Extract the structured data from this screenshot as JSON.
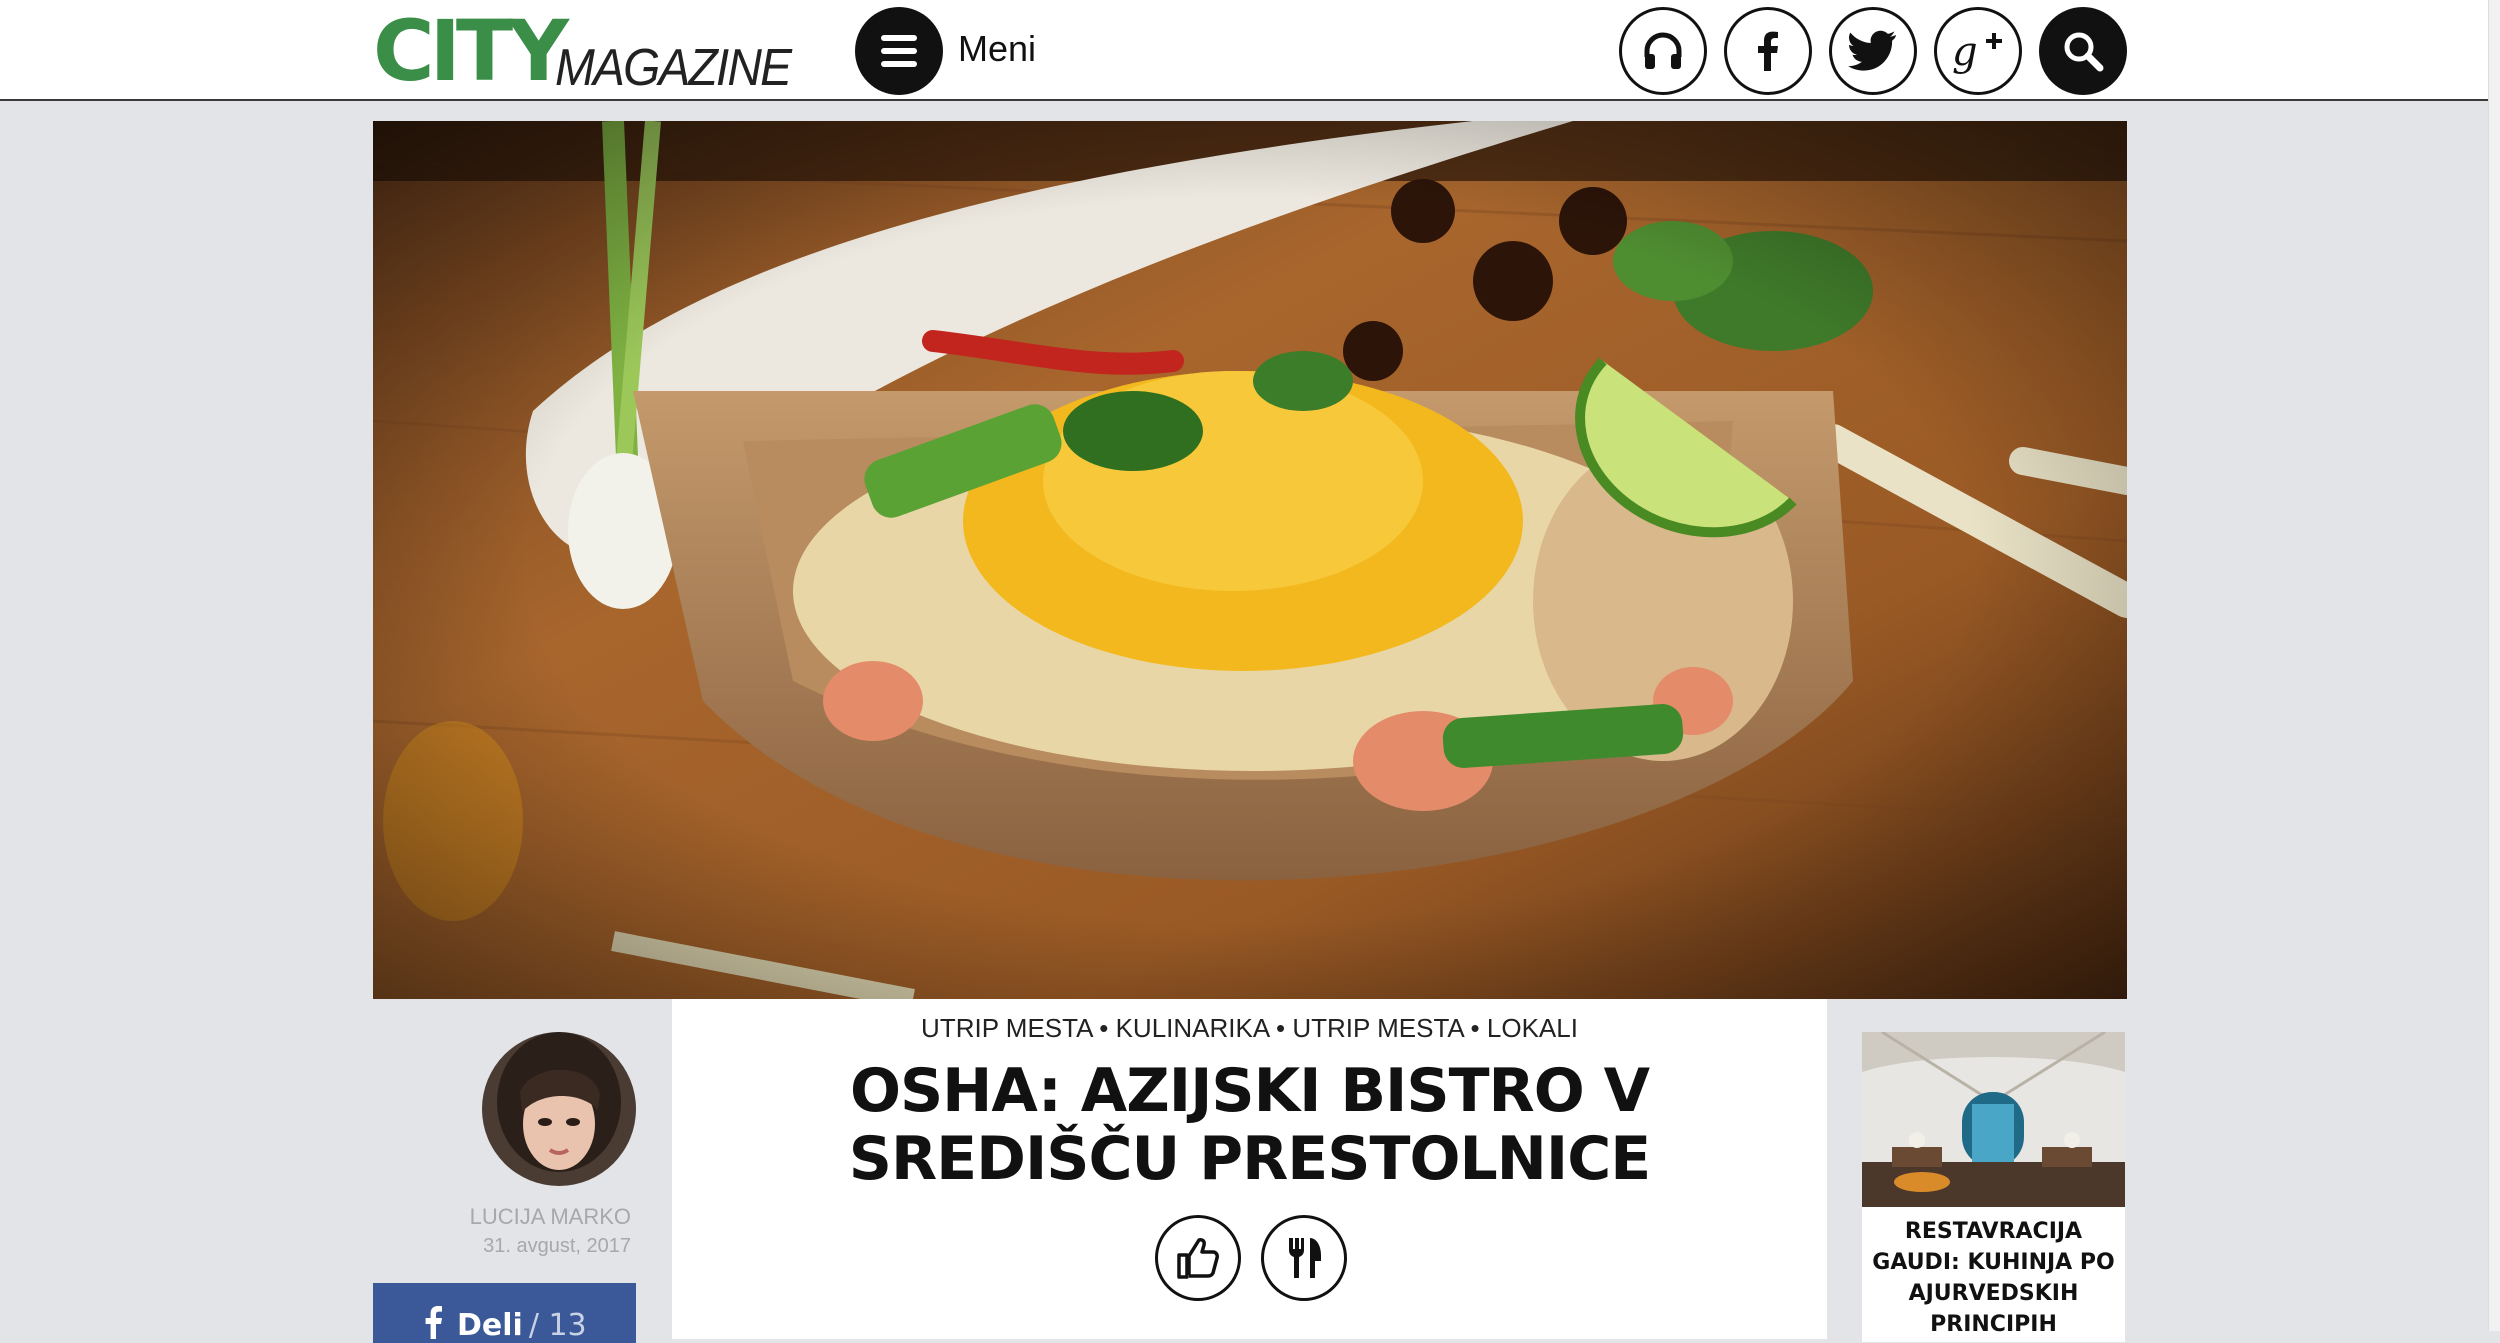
{
  "header": {
    "logo_city": "CITY",
    "logo_magazine": "MAGAZINE",
    "menu_label": "Meni",
    "social": [
      {
        "icon": "headphones-icon"
      },
      {
        "icon": "facebook-icon"
      },
      {
        "icon": "twitter-icon"
      },
      {
        "icon": "google-plus-icon"
      },
      {
        "icon": "search-icon"
      }
    ]
  },
  "hero": {
    "image": "photo of pad thai noodles with shrimp, egg strands, lime wedge and crushed peanuts in a kraft paper boat on a wooden board"
  },
  "author": {
    "name": "LUCIJA MARKO",
    "date": "31. avgust, 2017"
  },
  "share": {
    "label": "Deli",
    "count": "/ 13"
  },
  "article": {
    "categories": [
      "UTRIP MESTA",
      "KULINARIKA",
      "UTRIP MESTA",
      "LOKALI"
    ],
    "separator": "•",
    "title_line1": "OSHA: AZIJSKI BISTRO V",
    "title_line2": "SREDIŠČU PRESTOLNICE",
    "category_icons": [
      "thumbs-up-icon",
      "fork-knife-icon"
    ]
  },
  "related": {
    "title": "RESTAVRACIJA GAUDI: KUHINJA PO AJURVEDSKIH PRINCIPIH"
  },
  "colors": {
    "brand_green": "#3a8e48",
    "facebook_blue": "#3b5998",
    "page_bg": "#e2e4e7"
  }
}
